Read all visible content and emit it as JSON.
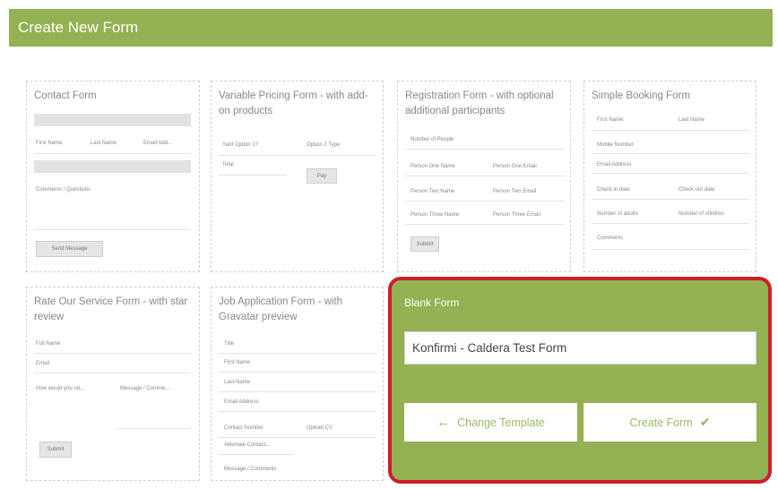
{
  "header": {
    "title": "Create New Form"
  },
  "templates": {
    "contact": {
      "title": "Contact Form",
      "fields": [
        "First Name",
        "Last Name",
        "Email Add..."
      ],
      "comments_label": "Comments / Questions",
      "button": "Send Message"
    },
    "variable": {
      "title": "Variable Pricing Form - with add-on products",
      "fields": [
        "Yard Option 1?",
        "Option 2 Type",
        "Total"
      ],
      "button": "Pay"
    },
    "registration": {
      "title": "Registration Form - with optional additional participants",
      "fields": [
        "Number of People",
        "Person One Name",
        "Person One Email",
        "Person Two Name",
        "Person Two Email",
        "Person Three Name",
        "Person Three Email"
      ],
      "button": "Submit"
    },
    "booking": {
      "title": "Simple Booking Form",
      "fields": [
        "First Name",
        "Last Name",
        "Mobile Number",
        "Email Address",
        "Check in date",
        "Check out date",
        "Number of adults",
        "Number of children",
        "Comments"
      ]
    },
    "rate": {
      "title": "Rate Our Service Form - with star review",
      "fields": [
        "Full Name",
        "Email",
        "How would you rat...",
        "Message / Comme..."
      ],
      "button": "Submit"
    },
    "job": {
      "title": "Job Application Form - with Gravatar preview",
      "fields": [
        "Title",
        "First Name",
        "Last Name",
        "Email Address",
        "Contact Number",
        "Upload CV",
        "Alternate Contact...",
        "Message / Comments"
      ]
    }
  },
  "blank_form": {
    "title": "Blank Form",
    "form_name_value": "Konfirmi - Caldera Test Form",
    "change_template_label": "Change Template",
    "create_form_label": "Create Form",
    "icons": {
      "change": "arrow-left-icon",
      "create": "checkmark-icon"
    }
  },
  "colors": {
    "header": "#94b153",
    "highlight_border": "#cc1f2a",
    "accent_text": "#9cb864"
  }
}
